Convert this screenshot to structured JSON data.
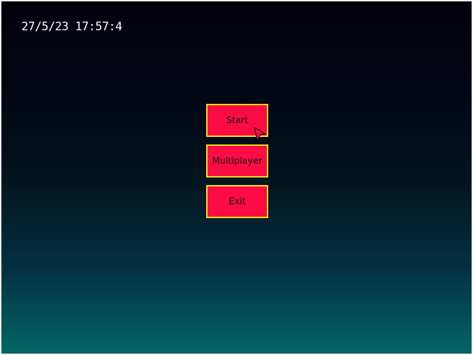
{
  "clock": {
    "datetime": "27/5/23 17:57:4"
  },
  "menu": {
    "start_label": "Start",
    "multiplayer_label": "Multiplayer",
    "exit_label": "Exit"
  },
  "colors": {
    "button_fill": "#fd0b45",
    "button_border": "#f6e41a",
    "background_top": "#01010d",
    "background_bottom": "#036566",
    "clock_text": "#ffffff"
  },
  "cursor": {
    "icon": "arrow-cursor-icon",
    "hovering": "start-button"
  }
}
